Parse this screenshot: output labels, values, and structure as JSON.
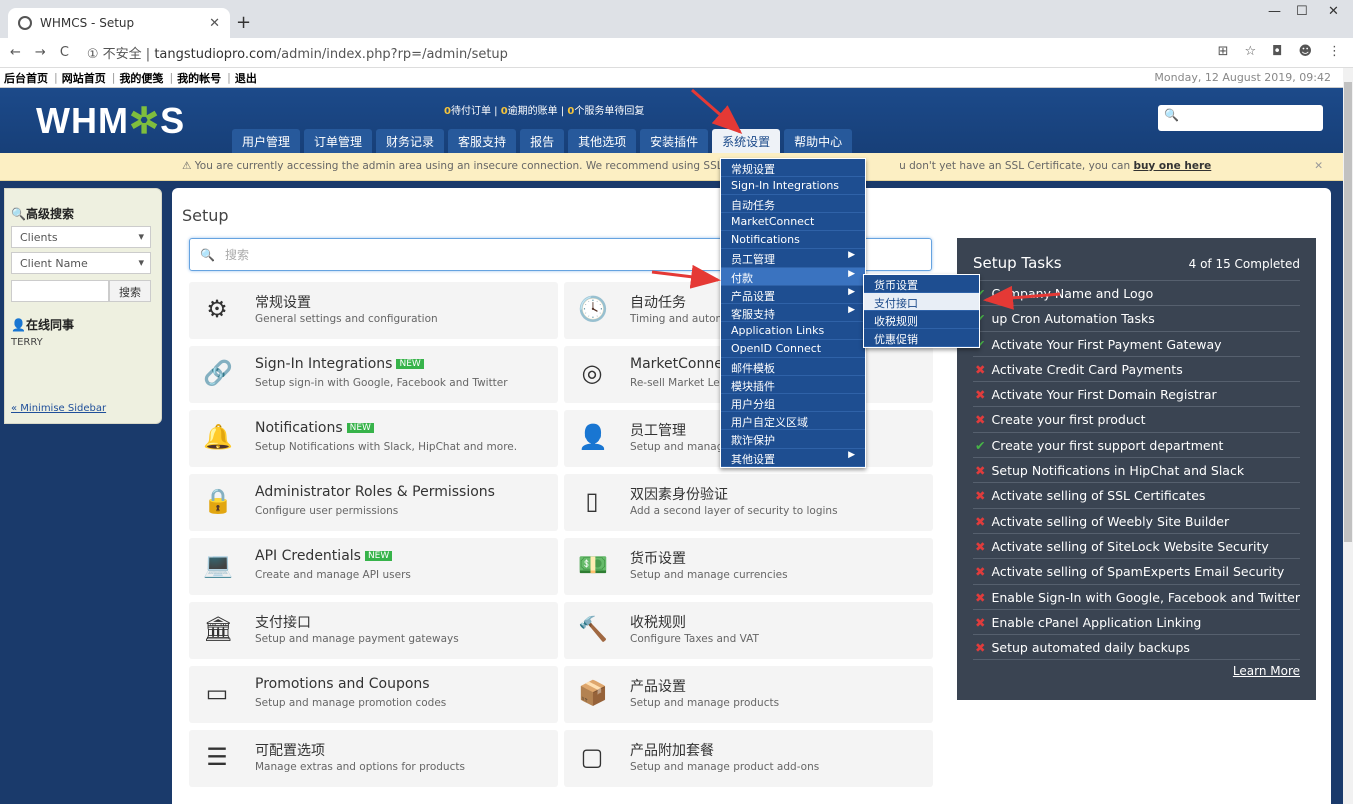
{
  "browser": {
    "tab_title": "WHMCS - Setup",
    "url_prefix": "① 不安全 | ",
    "url_host": "tangstudiopro.com",
    "url_path": "/admin/index.php?rp=/admin/setup"
  },
  "topbar": {
    "links": [
      "后台首页",
      "网站首页",
      "我的便笺",
      "我的帐号",
      "退出"
    ],
    "date": "Monday, 12 August 2019, 09:42"
  },
  "header": {
    "logo": "WHMCS",
    "stats": {
      "orders": "0",
      "orders_label": "待付订单",
      "invoices": "0",
      "invoices_label": "逾期的账单",
      "tickets": "0",
      "tickets_label": "个服务单待回复"
    },
    "nav": [
      "用户管理",
      "订单管理",
      "财务记录",
      "客服支持",
      "报告",
      "其他选项",
      "安装插件",
      "系统设置",
      "帮助中心"
    ]
  },
  "warning": {
    "text": "⚠ You are currently accessing the admin area using an insecure connection. We recommend using SSL encr",
    "text2": "u don't yet have an SSL Certificate, you can ",
    "link": "buy one here"
  },
  "sidebar": {
    "title": "高级搜索",
    "select1": "Clients",
    "select2": "Client Name",
    "search_btn": "搜索",
    "online_title": "在线同事",
    "online_user": "TERRY",
    "minimise": "« Minimise Sidebar"
  },
  "main": {
    "title": "Setup",
    "search_placeholder": "搜索",
    "cards": [
      {
        "title": "常规设置",
        "desc": "General settings and configuration",
        "icon": "gear-icon",
        "glyph": "⚙"
      },
      {
        "title": "自动任务",
        "desc": "Timing and autom",
        "icon": "clock-icon",
        "glyph": "🕓"
      },
      {
        "title": "Sign-In Integrations",
        "desc": "Setup sign-in with Google, Facebook and Twitter",
        "icon": "link-icon",
        "glyph": "🔗",
        "new": "NEW"
      },
      {
        "title": "MarketConne",
        "desc": "Re-sell Market Lea",
        "icon": "target-icon",
        "glyph": "◎"
      },
      {
        "title": "Notifications",
        "desc": "Setup Notifications with Slack, HipChat and more.",
        "icon": "bell-icon",
        "glyph": "🔔",
        "new": "NEW"
      },
      {
        "title": "员工管理",
        "desc": "Setup and manage",
        "icon": "user-icon",
        "glyph": "👤"
      },
      {
        "title": "Administrator Roles & Permissions",
        "desc": "Configure user permissions",
        "icon": "lock-icon",
        "glyph": "🔒"
      },
      {
        "title": "双因素身份验证",
        "desc": "Add a second layer of security to logins",
        "icon": "phone-icon",
        "glyph": "▯"
      },
      {
        "title": "API Credentials",
        "desc": "Create and manage API users",
        "icon": "laptop-icon",
        "glyph": "💻",
        "new": "NEW"
      },
      {
        "title": "货币设置",
        "desc": "Setup and manage currencies",
        "icon": "money-icon",
        "glyph": "💵"
      },
      {
        "title": "支付接口",
        "desc": "Setup and manage payment gateways",
        "icon": "bank-icon",
        "glyph": "🏛"
      },
      {
        "title": "收税规则",
        "desc": "Configure Taxes and VAT",
        "icon": "gavel-icon",
        "glyph": "🔨"
      },
      {
        "title": "Promotions and Coupons",
        "desc": "Setup and manage promotion codes",
        "icon": "ticket-icon",
        "glyph": "▭"
      },
      {
        "title": "产品设置",
        "desc": "Setup and manage products",
        "icon": "box-icon",
        "glyph": "📦"
      },
      {
        "title": "可配置选项",
        "desc": "Manage extras and options for products",
        "icon": "sliders-icon",
        "glyph": "☰"
      },
      {
        "title": "产品附加套餐",
        "desc": "Setup and manage product add-ons",
        "icon": "note-icon",
        "glyph": "▢"
      }
    ]
  },
  "tasks": {
    "title": "Setup Tasks",
    "completed": "4 of 15 Completed",
    "items": [
      {
        "text": "Company Name and Logo",
        "done": true
      },
      {
        "text": "up Cron Automation Tasks",
        "done": true
      },
      {
        "text": "Activate Your First Payment Gateway",
        "done": true
      },
      {
        "text": "Activate Credit Card Payments",
        "done": false
      },
      {
        "text": "Activate Your First Domain Registrar",
        "done": false
      },
      {
        "text": "Create your first product",
        "done": false
      },
      {
        "text": "Create your first support department",
        "done": true
      },
      {
        "text": "Setup Notifications in HipChat and Slack",
        "done": false
      },
      {
        "text": "Activate selling of SSL Certificates",
        "done": false
      },
      {
        "text": "Activate selling of Weebly Site Builder",
        "done": false
      },
      {
        "text": "Activate selling of SiteLock Website Security",
        "done": false
      },
      {
        "text": "Activate selling of SpamExperts Email Security",
        "done": false
      },
      {
        "text": "Enable Sign-In with Google, Facebook and Twitter",
        "done": false
      },
      {
        "text": "Enable cPanel Application Linking",
        "done": false
      },
      {
        "text": "Setup automated daily backups",
        "done": false
      }
    ],
    "learn_more": "Learn More"
  },
  "dropdown": {
    "items": [
      {
        "label": "常规设置"
      },
      {
        "label": "Sign-In Integrations"
      },
      {
        "label": "自动任务"
      },
      {
        "label": "MarketConnect"
      },
      {
        "label": "Notifications"
      },
      {
        "label": "员工管理",
        "sub": true
      },
      {
        "label": "付款",
        "sub": true,
        "active": true
      },
      {
        "label": "产品设置",
        "sub": true
      },
      {
        "label": "客服支持",
        "sub": true
      },
      {
        "label": "Application Links"
      },
      {
        "label": "OpenID Connect"
      },
      {
        "label": "邮件模板"
      },
      {
        "label": "模块插件"
      },
      {
        "label": "用户分组"
      },
      {
        "label": "用户自定义区域"
      },
      {
        "label": "欺诈保护"
      },
      {
        "label": "其他设置",
        "sub": true
      }
    ],
    "submenu": [
      "货币设置",
      "支付接口",
      "收税规则",
      "优惠促销"
    ]
  },
  "colors": {
    "brand": "#1c4a8a",
    "accent": "#7fbe3d",
    "annotation": "#e53935"
  }
}
